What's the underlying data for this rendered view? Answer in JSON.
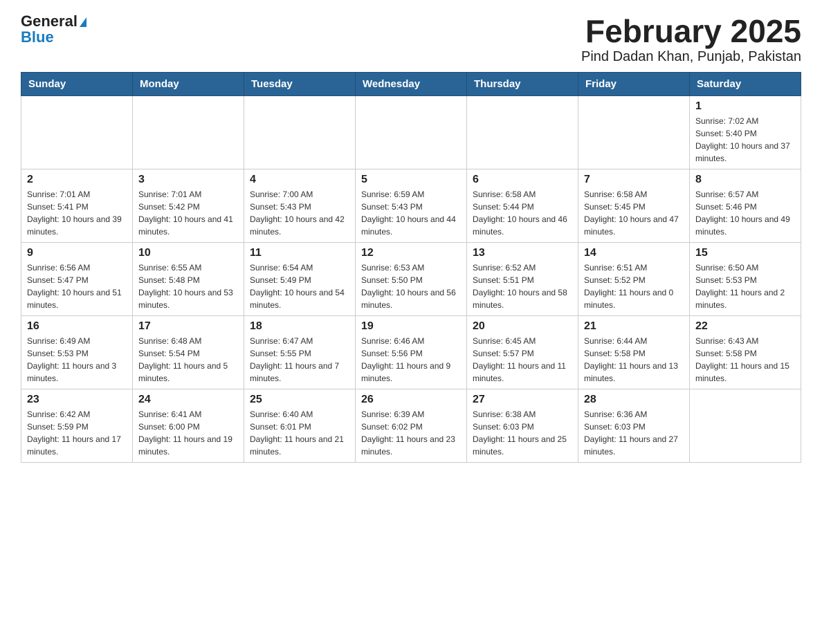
{
  "header": {
    "logo_general": "General",
    "logo_blue": "Blue",
    "title": "February 2025",
    "subtitle": "Pind Dadan Khan, Punjab, Pakistan"
  },
  "weekdays": [
    "Sunday",
    "Monday",
    "Tuesday",
    "Wednesday",
    "Thursday",
    "Friday",
    "Saturday"
  ],
  "weeks": [
    [
      {
        "day": "",
        "info": ""
      },
      {
        "day": "",
        "info": ""
      },
      {
        "day": "",
        "info": ""
      },
      {
        "day": "",
        "info": ""
      },
      {
        "day": "",
        "info": ""
      },
      {
        "day": "",
        "info": ""
      },
      {
        "day": "1",
        "info": "Sunrise: 7:02 AM\nSunset: 5:40 PM\nDaylight: 10 hours and 37 minutes."
      }
    ],
    [
      {
        "day": "2",
        "info": "Sunrise: 7:01 AM\nSunset: 5:41 PM\nDaylight: 10 hours and 39 minutes."
      },
      {
        "day": "3",
        "info": "Sunrise: 7:01 AM\nSunset: 5:42 PM\nDaylight: 10 hours and 41 minutes."
      },
      {
        "day": "4",
        "info": "Sunrise: 7:00 AM\nSunset: 5:43 PM\nDaylight: 10 hours and 42 minutes."
      },
      {
        "day": "5",
        "info": "Sunrise: 6:59 AM\nSunset: 5:43 PM\nDaylight: 10 hours and 44 minutes."
      },
      {
        "day": "6",
        "info": "Sunrise: 6:58 AM\nSunset: 5:44 PM\nDaylight: 10 hours and 46 minutes."
      },
      {
        "day": "7",
        "info": "Sunrise: 6:58 AM\nSunset: 5:45 PM\nDaylight: 10 hours and 47 minutes."
      },
      {
        "day": "8",
        "info": "Sunrise: 6:57 AM\nSunset: 5:46 PM\nDaylight: 10 hours and 49 minutes."
      }
    ],
    [
      {
        "day": "9",
        "info": "Sunrise: 6:56 AM\nSunset: 5:47 PM\nDaylight: 10 hours and 51 minutes."
      },
      {
        "day": "10",
        "info": "Sunrise: 6:55 AM\nSunset: 5:48 PM\nDaylight: 10 hours and 53 minutes."
      },
      {
        "day": "11",
        "info": "Sunrise: 6:54 AM\nSunset: 5:49 PM\nDaylight: 10 hours and 54 minutes."
      },
      {
        "day": "12",
        "info": "Sunrise: 6:53 AM\nSunset: 5:50 PM\nDaylight: 10 hours and 56 minutes."
      },
      {
        "day": "13",
        "info": "Sunrise: 6:52 AM\nSunset: 5:51 PM\nDaylight: 10 hours and 58 minutes."
      },
      {
        "day": "14",
        "info": "Sunrise: 6:51 AM\nSunset: 5:52 PM\nDaylight: 11 hours and 0 minutes."
      },
      {
        "day": "15",
        "info": "Sunrise: 6:50 AM\nSunset: 5:53 PM\nDaylight: 11 hours and 2 minutes."
      }
    ],
    [
      {
        "day": "16",
        "info": "Sunrise: 6:49 AM\nSunset: 5:53 PM\nDaylight: 11 hours and 3 minutes."
      },
      {
        "day": "17",
        "info": "Sunrise: 6:48 AM\nSunset: 5:54 PM\nDaylight: 11 hours and 5 minutes."
      },
      {
        "day": "18",
        "info": "Sunrise: 6:47 AM\nSunset: 5:55 PM\nDaylight: 11 hours and 7 minutes."
      },
      {
        "day": "19",
        "info": "Sunrise: 6:46 AM\nSunset: 5:56 PM\nDaylight: 11 hours and 9 minutes."
      },
      {
        "day": "20",
        "info": "Sunrise: 6:45 AM\nSunset: 5:57 PM\nDaylight: 11 hours and 11 minutes."
      },
      {
        "day": "21",
        "info": "Sunrise: 6:44 AM\nSunset: 5:58 PM\nDaylight: 11 hours and 13 minutes."
      },
      {
        "day": "22",
        "info": "Sunrise: 6:43 AM\nSunset: 5:58 PM\nDaylight: 11 hours and 15 minutes."
      }
    ],
    [
      {
        "day": "23",
        "info": "Sunrise: 6:42 AM\nSunset: 5:59 PM\nDaylight: 11 hours and 17 minutes."
      },
      {
        "day": "24",
        "info": "Sunrise: 6:41 AM\nSunset: 6:00 PM\nDaylight: 11 hours and 19 minutes."
      },
      {
        "day": "25",
        "info": "Sunrise: 6:40 AM\nSunset: 6:01 PM\nDaylight: 11 hours and 21 minutes."
      },
      {
        "day": "26",
        "info": "Sunrise: 6:39 AM\nSunset: 6:02 PM\nDaylight: 11 hours and 23 minutes."
      },
      {
        "day": "27",
        "info": "Sunrise: 6:38 AM\nSunset: 6:03 PM\nDaylight: 11 hours and 25 minutes."
      },
      {
        "day": "28",
        "info": "Sunrise: 6:36 AM\nSunset: 6:03 PM\nDaylight: 11 hours and 27 minutes."
      },
      {
        "day": "",
        "info": ""
      }
    ]
  ]
}
